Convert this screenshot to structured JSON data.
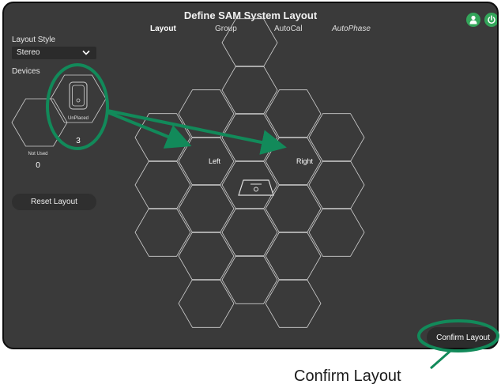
{
  "window": {
    "title": "Define SAM System Layout"
  },
  "tabs": [
    {
      "label": "Layout"
    },
    {
      "label": "Group"
    },
    {
      "label": "AutoCal"
    },
    {
      "label": "AutoPhase"
    }
  ],
  "sidebar": {
    "layout_style_label": "Layout Style",
    "layout_style_value": "Stereo",
    "devices_label": "Devices",
    "unplaced": {
      "label": "UnPlaced",
      "count": "3"
    },
    "not_used": {
      "label": "Not Used",
      "count": "0"
    },
    "reset_label": "Reset Layout"
  },
  "grid": {
    "left_label": "Left",
    "right_label": "Right"
  },
  "footer": {
    "confirm_label": "Confirm Layout"
  },
  "annotation": {
    "caption": "Confirm Layout",
    "color": "#128a5a"
  },
  "icons": {
    "user": "user-icon",
    "power": "power-icon",
    "speaker": "speaker-icon",
    "chevron": "chevron-down-icon"
  },
  "colors": {
    "accent_green": "#33a55a",
    "background": "#3a3a3a"
  }
}
